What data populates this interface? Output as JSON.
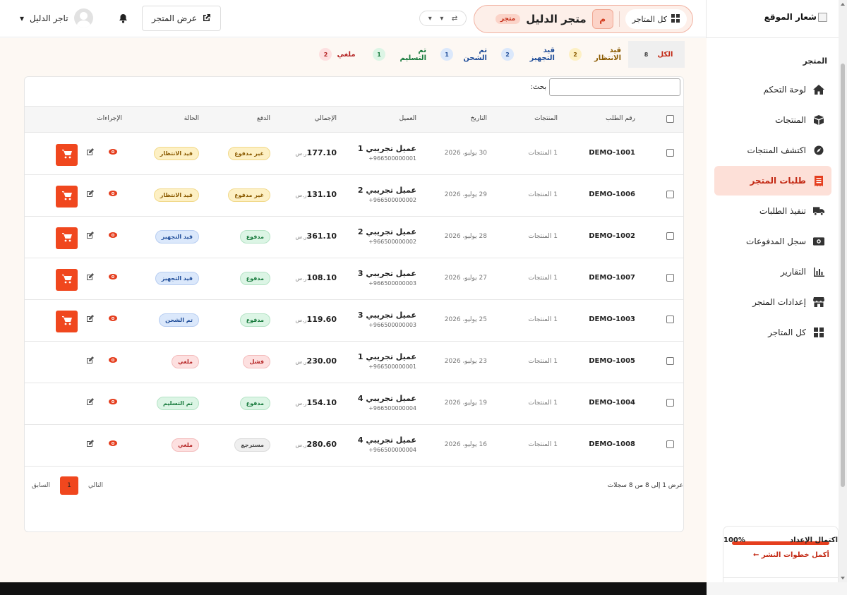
{
  "sidebar": {
    "logo_text": "شعار الموقع",
    "section_title": "المتجر",
    "items": [
      {
        "label": "لوحة التحكم",
        "icon": "home-icon",
        "active": false
      },
      {
        "label": "المنتجات",
        "icon": "box-icon",
        "active": false
      },
      {
        "label": "اكتشف المنتجات",
        "icon": "compass-icon",
        "active": false
      },
      {
        "label": "طلبات المتجر",
        "icon": "receipt-icon",
        "active": true
      },
      {
        "label": "تنفيذ الطلبات",
        "icon": "truck-icon",
        "active": false
      },
      {
        "label": "سجل المدفوعات",
        "icon": "money-icon",
        "active": false
      },
      {
        "label": "التقارير",
        "icon": "chart-icon",
        "active": false
      },
      {
        "label": "إعدادات المتجر",
        "icon": "store-icon",
        "active": false
      },
      {
        "label": "كل المتاجر",
        "icon": "grid-icon",
        "active": false
      }
    ],
    "setup": {
      "title": "اكتمال الإعداد",
      "percent": "100%",
      "progress": 1.0,
      "link": "أكمل خطوات النشر ←"
    }
  },
  "topbar": {
    "all_stores_label": "كل المتاجر",
    "store_initial": "م",
    "store_name": "متجر الدليل",
    "store_tag": "متجر",
    "view_store_label": "عرض المتجر",
    "user_name": "تاجر الدليل"
  },
  "status_tabs": [
    {
      "label": "الكل",
      "count": "8",
      "active": true,
      "color": "#c32a15",
      "count_bg": "transparent",
      "count_color": "#444"
    },
    {
      "label": "قيد الانتظار",
      "count": "2",
      "active": false,
      "color": "#8a5a00",
      "count_bg": "#fdf0c4",
      "count_color": "#8a5a00"
    },
    {
      "label": "قيد التجهيز",
      "count": "2",
      "active": false,
      "color": "#1f4d99",
      "count_bg": "#dbe8fb",
      "count_color": "#1f4d99"
    },
    {
      "label": "تم الشحن",
      "count": "1",
      "active": false,
      "color": "#1f4d99",
      "count_bg": "#dbe8fb",
      "count_color": "#1f4d99"
    },
    {
      "label": "تم التسليم",
      "count": "1",
      "active": false,
      "color": "#177a3c",
      "count_bg": "#dcf5e5",
      "count_color": "#177a3c"
    },
    {
      "label": "ملغي",
      "count": "2",
      "active": false,
      "color": "#b42323",
      "count_bg": "#fde0e0",
      "count_color": "#b42323"
    }
  ],
  "table": {
    "search_label": "بحث:",
    "headers": {
      "order": "رقم الطلب",
      "products": "المنتجات",
      "date": "التاريخ",
      "customer": "العميل",
      "total": "الإجمالي",
      "payment": "الدفع",
      "status": "الحالة",
      "actions": "الإجراءات"
    },
    "currency": "ر.س",
    "rows": [
      {
        "order": "DEMO-1001",
        "products": "1 المنتجات",
        "date": "30 يوليو، 2026",
        "customer": "عميل تجريبي 1",
        "phone": "+966500000001",
        "total": "177.10",
        "payment": "غير مدفوع",
        "payment_class": "b-yellow",
        "status": "قيد الانتظار",
        "status_class": "b-yellow",
        "cart": true
      },
      {
        "order": "DEMO-1006",
        "products": "1 المنتجات",
        "date": "29 يوليو، 2026",
        "customer": "عميل تجريبي 2",
        "phone": "+966500000002",
        "total": "131.10",
        "payment": "غير مدفوع",
        "payment_class": "b-yellow",
        "status": "قيد الانتظار",
        "status_class": "b-yellow",
        "cart": true
      },
      {
        "order": "DEMO-1002",
        "products": "1 المنتجات",
        "date": "28 يوليو، 2026",
        "customer": "عميل تجريبي 2",
        "phone": "+966500000002",
        "total": "361.10",
        "payment": "مدفوع",
        "payment_class": "b-green",
        "status": "قيد التجهيز",
        "status_class": "b-blue",
        "cart": true
      },
      {
        "order": "DEMO-1007",
        "products": "1 المنتجات",
        "date": "27 يوليو، 2026",
        "customer": "عميل تجريبي 3",
        "phone": "+966500000003",
        "total": "108.10",
        "payment": "مدفوع",
        "payment_class": "b-green",
        "status": "قيد التجهيز",
        "status_class": "b-blue",
        "cart": true
      },
      {
        "order": "DEMO-1003",
        "products": "1 المنتجات",
        "date": "25 يوليو، 2026",
        "customer": "عميل تجريبي 3",
        "phone": "+966500000003",
        "total": "119.60",
        "payment": "مدفوع",
        "payment_class": "b-green",
        "status": "تم الشحن",
        "status_class": "b-blue",
        "cart": true
      },
      {
        "order": "DEMO-1005",
        "products": "1 المنتجات",
        "date": "23 يوليو، 2026",
        "customer": "عميل تجريبي 1",
        "phone": "+966500000001",
        "total": "230.00",
        "payment": "فشل",
        "payment_class": "b-red",
        "status": "ملغي",
        "status_class": "b-red",
        "cart": false
      },
      {
        "order": "DEMO-1004",
        "products": "1 المنتجات",
        "date": "19 يوليو، 2026",
        "customer": "عميل تجريبي 4",
        "phone": "+966500000004",
        "total": "154.10",
        "payment": "مدفوع",
        "payment_class": "b-green",
        "status": "تم التسليم",
        "status_class": "b-green",
        "cart": false
      },
      {
        "order": "DEMO-1008",
        "products": "1 المنتجات",
        "date": "16 يوليو، 2026",
        "customer": "عميل تجريبي 4",
        "phone": "+966500000004",
        "total": "280.60",
        "payment": "مسترجع",
        "payment_class": "b-gray",
        "status": "ملغي",
        "status_class": "b-red",
        "cart": false
      }
    ],
    "footer_info": "عرض 1 إلى 8 من 8 سجلات",
    "pager": {
      "prev": "السابق",
      "current": "1",
      "next": "التالي"
    }
  },
  "colors": {
    "accent": "#f0471e",
    "accent_dark": "#c32a15",
    "active_bg": "#fde0d8"
  }
}
